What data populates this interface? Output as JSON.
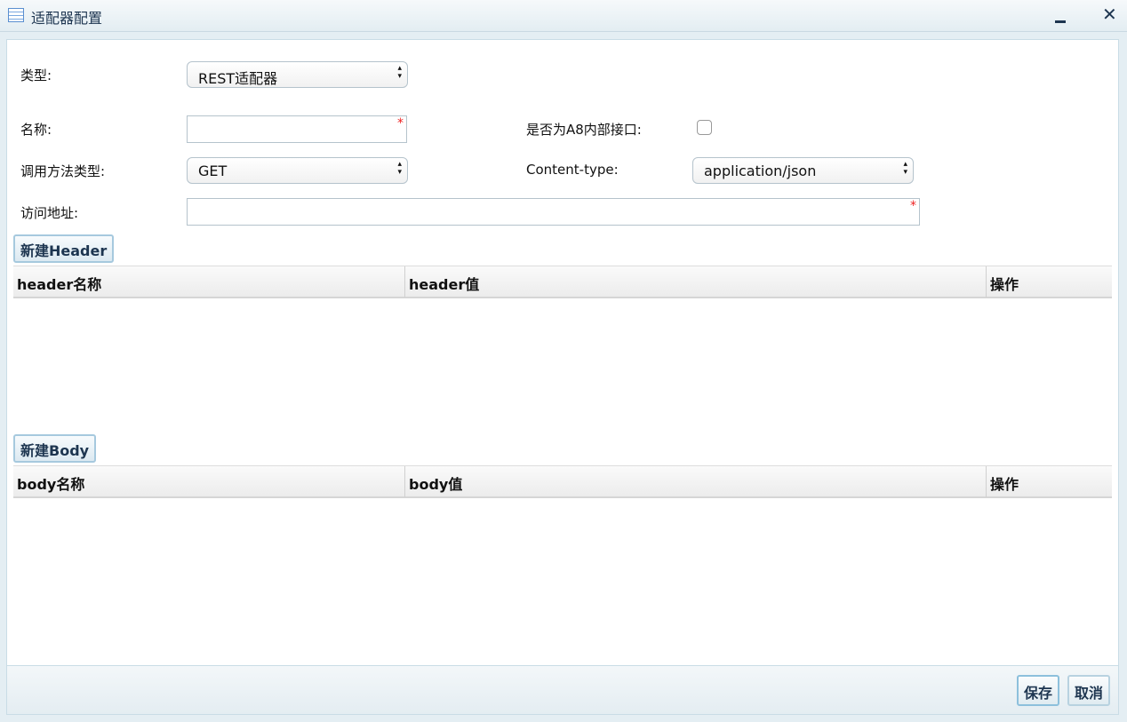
{
  "window": {
    "title": "适配器配置"
  },
  "form": {
    "type_label": "类型:",
    "type_value": "REST适配器",
    "name_label": "名称:",
    "name_value": "",
    "internal_label": "是否为A8内部接口:",
    "method_label": "调用方法类型:",
    "method_value": "GET",
    "content_type_label": "Content-type:",
    "content_type_value": "application/json",
    "url_label": "访问地址:",
    "url_value": "",
    "required_mark": "*"
  },
  "header": {
    "new_button": "新建Header",
    "columns": [
      "header名称",
      "header值",
      "操作"
    ]
  },
  "body": {
    "new_button": "新建Body",
    "columns": [
      "body名称",
      "body值",
      "操作"
    ]
  },
  "footer": {
    "save": "保存",
    "cancel": "取消"
  }
}
